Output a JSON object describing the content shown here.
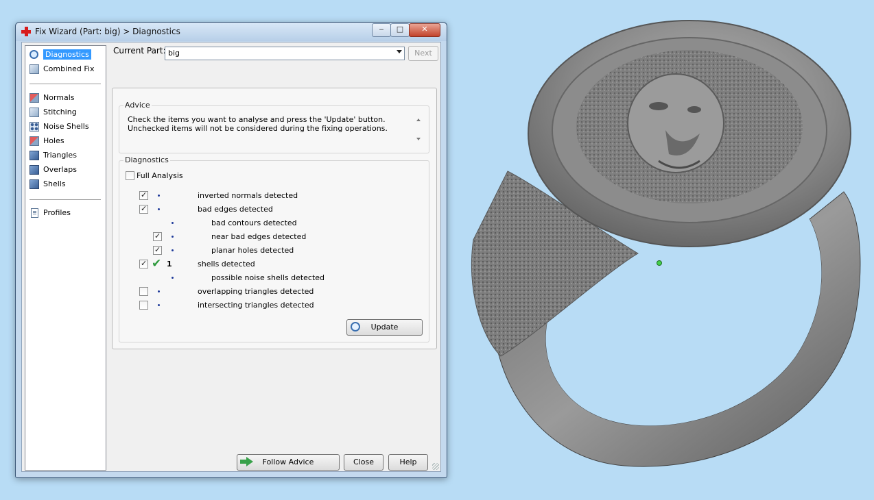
{
  "window": {
    "title": "Fix Wizard (Part: big) > Diagnostics"
  },
  "titlebar_controls": {
    "minimize": "‒",
    "maximize": "□",
    "close": "✕"
  },
  "nav": {
    "items": [
      {
        "label": "Diagnostics",
        "icon": "magnifier-icon",
        "selected": true
      },
      {
        "label": "Combined Fix",
        "icon": "cube-icon"
      },
      {
        "label": "Normals",
        "icon": "normals-cube-icon"
      },
      {
        "label": "Stitching",
        "icon": "stitching-cube-icon"
      },
      {
        "label": "Noise Shells",
        "icon": "noise-shells-icon"
      },
      {
        "label": "Holes",
        "icon": "holes-cube-icon"
      },
      {
        "label": "Triangles",
        "icon": "triangles-cube-icon"
      },
      {
        "label": "Overlaps",
        "icon": "overlaps-cube-icon"
      },
      {
        "label": "Shells",
        "icon": "shells-cube-icon"
      },
      {
        "label": "Profiles",
        "icon": "document-icon"
      }
    ]
  },
  "current_part": {
    "label": "Current Part:",
    "value": "big"
  },
  "buttons": {
    "next": "Next",
    "update": "Update",
    "follow_advice": "Follow Advice",
    "close": "Close",
    "help": "Help"
  },
  "advice": {
    "title": "Advice",
    "text": "Check the items you want to analyse and press the 'Update' button. Unchecked items will not be considered during the fixing operations."
  },
  "diagnostics": {
    "title": "Diagnostics",
    "full_analysis": {
      "label": "Full Analysis",
      "checked": false
    },
    "rows": [
      {
        "label": "inverted normals detected",
        "checked": true,
        "indent": 0,
        "status": ""
      },
      {
        "label": "bad edges detected",
        "checked": true,
        "indent": 0,
        "status": ""
      },
      {
        "label": "bad contours detected",
        "checked": null,
        "indent": 1,
        "status": ""
      },
      {
        "label": "near bad edges detected",
        "checked": true,
        "indent": 1,
        "status": ""
      },
      {
        "label": "planar holes detected",
        "checked": true,
        "indent": 1,
        "status": ""
      },
      {
        "label": "shells detected",
        "checked": true,
        "indent": 0,
        "status": "ok",
        "count": "1"
      },
      {
        "label": "possible noise shells detected",
        "checked": null,
        "indent": 1,
        "status": ""
      },
      {
        "label": "overlapping triangles detected",
        "checked": false,
        "indent": 0,
        "status": ""
      },
      {
        "label": "intersecting triangles detected",
        "checked": false,
        "indent": 0,
        "status": ""
      }
    ]
  },
  "colors": {
    "background": "#b8dcf5",
    "selection": "#3399ff",
    "ok_check": "#2e9a3d",
    "ring_metal": "#7c7c7c"
  }
}
